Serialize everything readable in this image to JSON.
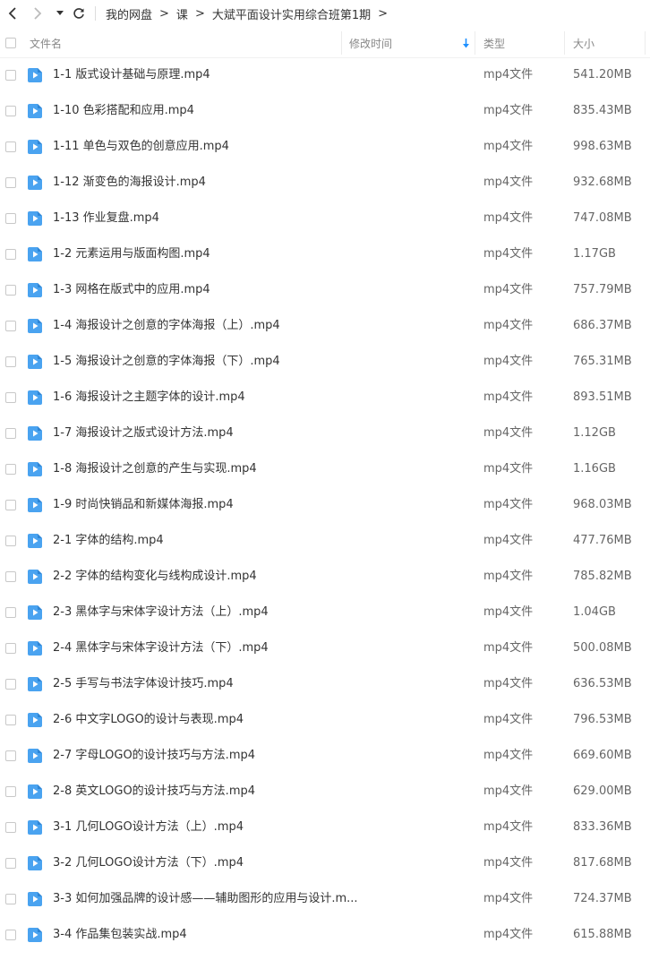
{
  "breadcrumb": [
    "我的网盘",
    "课",
    "大斌平面设计实用综合班第1期"
  ],
  "columns": {
    "name": "文件名",
    "modified": "修改时间",
    "type": "类型",
    "size": "大小"
  },
  "accent_color": "#4aa3f0",
  "files": [
    {
      "name": "1-1 版式设计基础与原理.mp4",
      "type": "mp4文件",
      "size": "541.20MB"
    },
    {
      "name": "1-10 色彩搭配和应用.mp4",
      "type": "mp4文件",
      "size": "835.43MB"
    },
    {
      "name": "1-11 单色与双色的创意应用.mp4",
      "type": "mp4文件",
      "size": "998.63MB"
    },
    {
      "name": "1-12 渐变色的海报设计.mp4",
      "type": "mp4文件",
      "size": "932.68MB"
    },
    {
      "name": "1-13 作业复盘.mp4",
      "type": "mp4文件",
      "size": "747.08MB"
    },
    {
      "name": "1-2 元素运用与版面构图.mp4",
      "type": "mp4文件",
      "size": "1.17GB"
    },
    {
      "name": "1-3 网格在版式中的应用.mp4",
      "type": "mp4文件",
      "size": "757.79MB"
    },
    {
      "name": "1-4 海报设计之创意的字体海报（上）.mp4",
      "type": "mp4文件",
      "size": "686.37MB"
    },
    {
      "name": "1-5 海报设计之创意的字体海报（下）.mp4",
      "type": "mp4文件",
      "size": "765.31MB"
    },
    {
      "name": "1-6 海报设计之主题字体的设计.mp4",
      "type": "mp4文件",
      "size": "893.51MB"
    },
    {
      "name": "1-7 海报设计之版式设计方法.mp4",
      "type": "mp4文件",
      "size": "1.12GB"
    },
    {
      "name": "1-8 海报设计之创意的产生与实现.mp4",
      "type": "mp4文件",
      "size": "1.16GB"
    },
    {
      "name": "1-9 时尚快销品和新媒体海报.mp4",
      "type": "mp4文件",
      "size": "968.03MB"
    },
    {
      "name": "2-1 字体的结构.mp4",
      "type": "mp4文件",
      "size": "477.76MB"
    },
    {
      "name": "2-2 字体的结构变化与线构成设计.mp4",
      "type": "mp4文件",
      "size": "785.82MB"
    },
    {
      "name": "2-3 黑体字与宋体字设计方法（上）.mp4",
      "type": "mp4文件",
      "size": "1.04GB"
    },
    {
      "name": "2-4 黑体字与宋体字设计方法（下）.mp4",
      "type": "mp4文件",
      "size": "500.08MB"
    },
    {
      "name": "2-5 手写与书法字体设计技巧.mp4",
      "type": "mp4文件",
      "size": "636.53MB"
    },
    {
      "name": "2-6 中文字LOGO的设计与表现.mp4",
      "type": "mp4文件",
      "size": "796.53MB"
    },
    {
      "name": "2-7 字母LOGO的设计技巧与方法.mp4",
      "type": "mp4文件",
      "size": "669.60MB"
    },
    {
      "name": "2-8 英文LOGO的设计技巧与方法.mp4",
      "type": "mp4文件",
      "size": "629.00MB"
    },
    {
      "name": "3-1 几何LOGO设计方法（上）.mp4",
      "type": "mp4文件",
      "size": "833.36MB"
    },
    {
      "name": "3-2 几何LOGO设计方法（下）.mp4",
      "type": "mp4文件",
      "size": "817.68MB"
    },
    {
      "name": "3-3 如何加强品牌的设计感——辅助图形的应用与设计.m...",
      "type": "mp4文件",
      "size": "724.37MB"
    },
    {
      "name": "3-4 作品集包装实战.mp4",
      "type": "mp4文件",
      "size": "615.88MB"
    }
  ]
}
